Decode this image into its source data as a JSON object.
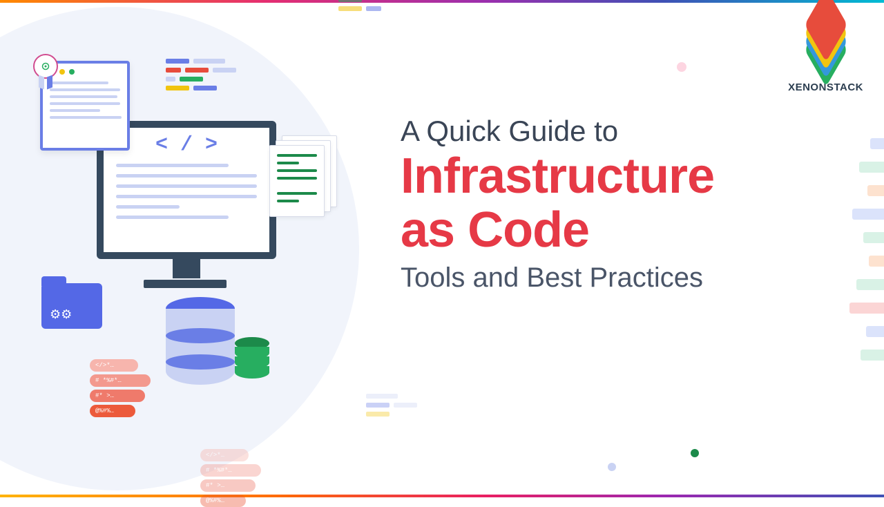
{
  "brand": {
    "name": "XENONSTACK"
  },
  "headline": {
    "line1": "A Quick Guide to",
    "line2_a": "Infrastructure",
    "line2_b": "as Code",
    "line3": "Tools and Best Practices"
  },
  "illustration": {
    "code_tag": "< / >",
    "pill_a": "</>*…",
    "pill_b": "# *%#*…",
    "pill_c": "#* >…",
    "pill_d": "@%#%…"
  }
}
